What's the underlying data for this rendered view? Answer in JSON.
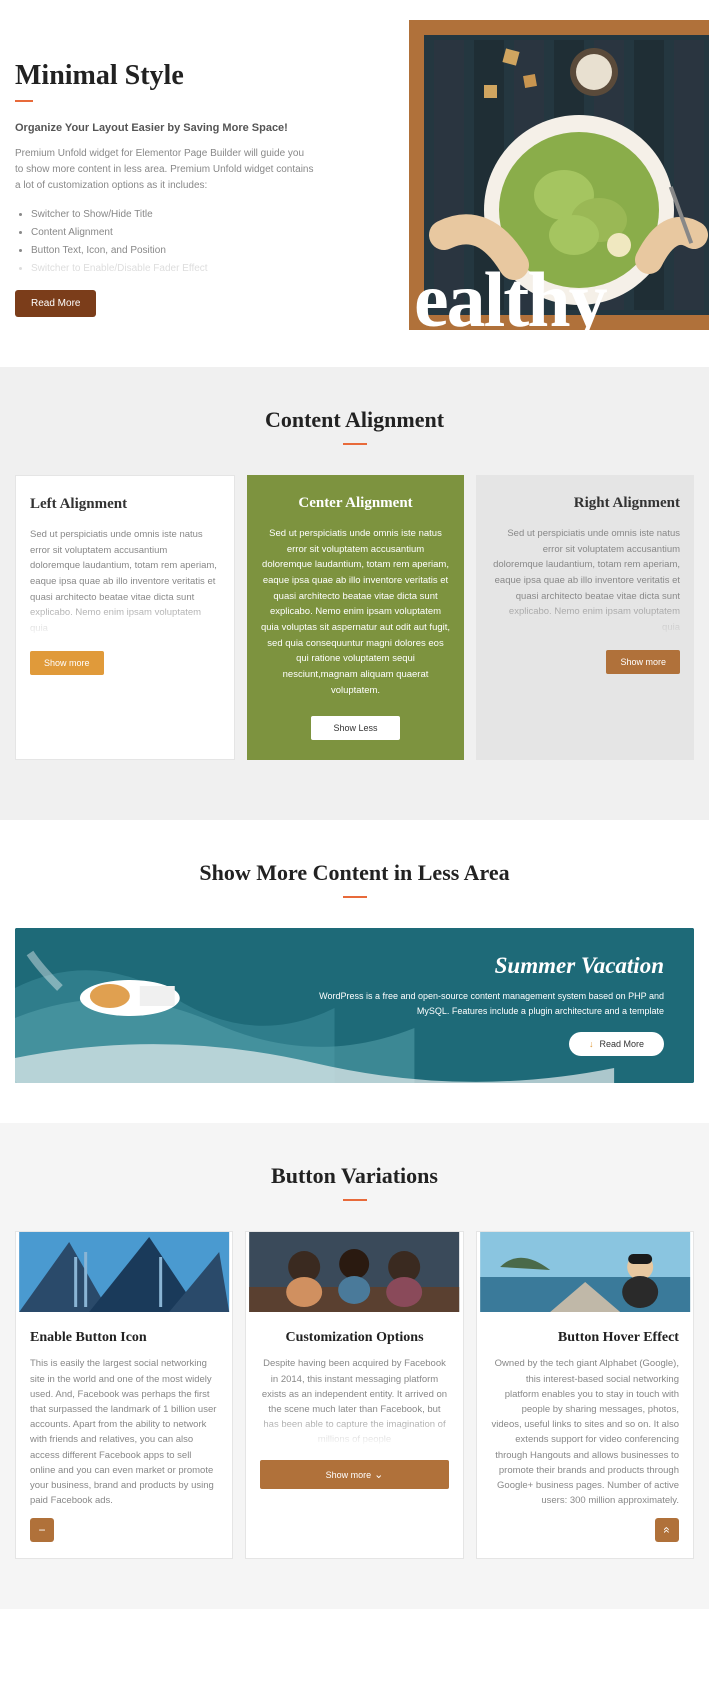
{
  "hero": {
    "title": "Minimal Style",
    "subtitle": "Organize Your Layout Easier by Saving More Space!",
    "desc": "Premium Unfold widget for Elementor Page Builder will guide you to show more content in less area. Premium Unfold widget contains a lot of customization options as it includes:",
    "list": [
      "Switcher to Show/Hide Title",
      "Content Alignment",
      "Button Text, Icon, and Position",
      "Switcher to Enable/Disable Fader Effect"
    ],
    "button": "Read More",
    "bigtext": "ealthy"
  },
  "alignment": {
    "heading": "Content Alignment",
    "left": {
      "title": "Left Alignment",
      "text": "Sed ut perspiciatis unde omnis iste natus error sit voluptatem accusantium doloremque laudantium, totam rem aperiam, eaque ipsa quae ab illo inventore veritatis et quasi architecto beatae vitae dicta sunt explicabo. Nemo enim ipsam voluptatem quia",
      "button": "Show more"
    },
    "center": {
      "title": "Center Alignment",
      "text": "Sed ut perspiciatis unde omnis iste natus error sit voluptatem accusantium doloremque laudantium, totam rem aperiam, eaque ipsa quae ab illo inventore veritatis et quasi architecto beatae vitae dicta sunt explicabo. Nemo enim ipsam voluptatem quia voluptas sit aspernatur aut odit aut fugit, sed quia consequuntur magni dolores eos qui ratione voluptatem sequi nesciunt,magnam aliquam quaerat voluptatem.",
      "button": "Show Less"
    },
    "right": {
      "title": "Right Alignment",
      "text": "Sed ut perspiciatis unde omnis iste natus error sit voluptatem accusantium doloremque laudantium, totam rem aperiam, eaque ipsa quae ab illo inventore veritatis et quasi architecto beatae vitae dicta sunt explicabo. Nemo enim ipsam voluptatem quia",
      "button": "Show more"
    }
  },
  "banner": {
    "heading": "Show More Content in Less Area",
    "title": "Summer Vacation",
    "text": "WordPress is a free and open-source content management system based on PHP and MySQL. Features include a plugin architecture and a template",
    "button": "Read More"
  },
  "variations": {
    "heading": "Button Variations",
    "cards": [
      {
        "title": "Enable Button Icon",
        "text": "This is easily the largest social networking site in the world and one of the most widely used. And, Facebook was perhaps the first that surpassed the landmark of 1 billion user accounts. Apart from the ability to network with friends and relatives, you can also access different Facebook apps to sell online and you can even market or promote your business, brand and products by using paid Facebook ads.",
        "button": "−"
      },
      {
        "title": "Customization Options",
        "text": "Despite having been acquired by Facebook in 2014, this instant messaging platform exists as an independent entity. It arrived on the scene much later than Facebook, but has been able to capture the imagination of millions of people",
        "button": "Show more"
      },
      {
        "title": "Button Hover Effect",
        "text": "Owned by the tech giant Alphabet (Google), this interest-based social networking platform enables you to stay in touch with people by sharing messages, photos, videos, useful links to sites and so on. It also extends support for video conferencing through Hangouts and allows businesses to promote their brands and products through Google+ business pages. Number of active users: 300 million approximately.",
        "button": "⌃"
      }
    ]
  }
}
